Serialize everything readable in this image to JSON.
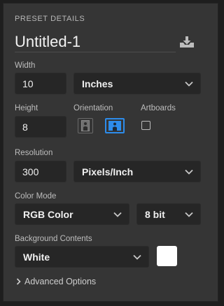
{
  "panel": {
    "heading": "PRESET DETAILS",
    "doc_name": "Untitled-1",
    "save_icon": "download-tray-icon"
  },
  "width": {
    "label": "Width",
    "value": "10",
    "unit": "Inches"
  },
  "height": {
    "label": "Height",
    "value": "8"
  },
  "orientation": {
    "label": "Orientation",
    "options": [
      "portrait",
      "landscape"
    ],
    "selected": "landscape"
  },
  "artboards": {
    "label": "Artboards",
    "checked": false
  },
  "resolution": {
    "label": "Resolution",
    "value": "300",
    "unit": "Pixels/Inch"
  },
  "color_mode": {
    "label": "Color Mode",
    "mode": "RGB Color",
    "depth": "8 bit"
  },
  "background": {
    "label": "Background Contents",
    "value": "White",
    "swatch_color": "#ffffff"
  },
  "advanced": {
    "label": "Advanced Options"
  },
  "colors": {
    "panel": "#353535",
    "field": "#262626",
    "accent": "#2d8ceb"
  }
}
